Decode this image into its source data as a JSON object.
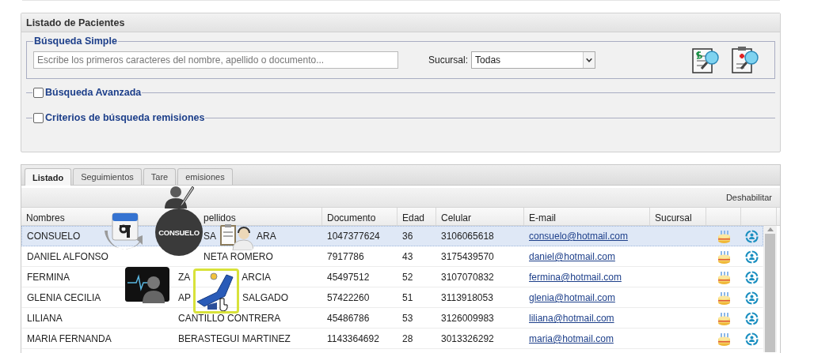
{
  "panel": {
    "title": "Listado de Pacientes"
  },
  "simple_search": {
    "legend": "Búsqueda Simple",
    "placeholder": "Escribe los primeros caracteres del nombre, apellido o documento...",
    "branch_label": "Sucursal:",
    "branch_value": "Todas"
  },
  "options": [
    {
      "label": "Búsqueda Avanzada",
      "checked": false
    },
    {
      "label": "Criterios de búsqueda remisiones",
      "checked": false
    }
  ],
  "tabs": [
    {
      "label": "Listado",
      "selected": true
    },
    {
      "label": "Seguimientos",
      "selected": false
    },
    {
      "label": "Tare",
      "selected": false
    },
    {
      "label": "emisiones",
      "selected": false
    }
  ],
  "toolbar": {
    "action": "Deshabilitar"
  },
  "table": {
    "columns": [
      "Nombres",
      "pellidos",
      "Documento",
      "Edad",
      "Celular",
      "E-mail",
      "Sucursal"
    ],
    "rows": [
      {
        "nombres": "CONSUELO",
        "apellidos": [
          "SA",
          "ARA"
        ],
        "documento": "1047377624",
        "edad": "36",
        "celular": "3106065618",
        "email": "consuelo@hotmail.com",
        "selected": true
      },
      {
        "nombres": "DANIEL ALFONSO",
        "apellidos": [
          "NETA ROMERO"
        ],
        "documento": "7917786",
        "edad": "43",
        "celular": "3175439570",
        "email": "daniel@hotmail.com",
        "selected": false
      },
      {
        "nombres": "FERMINA",
        "apellidos": [
          "ZA",
          "ARCIA"
        ],
        "documento": "45497512",
        "edad": "52",
        "celular": "3107070832",
        "email": "fermina@hotmail.com",
        "selected": false
      },
      {
        "nombres": "GLENIA CECILIA",
        "apellidos": [
          "AP",
          "SALGADO"
        ],
        "documento": "57422260",
        "edad": "51",
        "celular": "3113918053",
        "email": "glenia@hotmail.com",
        "selected": false
      },
      {
        "nombres": "LILIANA",
        "apellidos": [
          "CANTILLO CONTRERA"
        ],
        "documento": "45486786",
        "edad": "53",
        "celular": "3126009983",
        "email": "liliana@hotmail.com",
        "selected": false
      },
      {
        "nombres": "MARIA FERNANDA",
        "apellidos": [
          "BERASTEGUI MARTINEZ"
        ],
        "documento": "1143364692",
        "edad": "28",
        "celular": "3013326292",
        "email": "maria@hotmail.com",
        "selected": false
      }
    ]
  },
  "radial_menu": {
    "center_label": "CONSUELO",
    "items": [
      {
        "kind": "profile-edit",
        "selected": false
      },
      {
        "kind": "calendar",
        "selected": false
      },
      {
        "kind": "call-center",
        "selected": false
      },
      {
        "kind": "monitor",
        "selected": false
      },
      {
        "kind": "dental-chair",
        "selected": true
      }
    ]
  }
}
